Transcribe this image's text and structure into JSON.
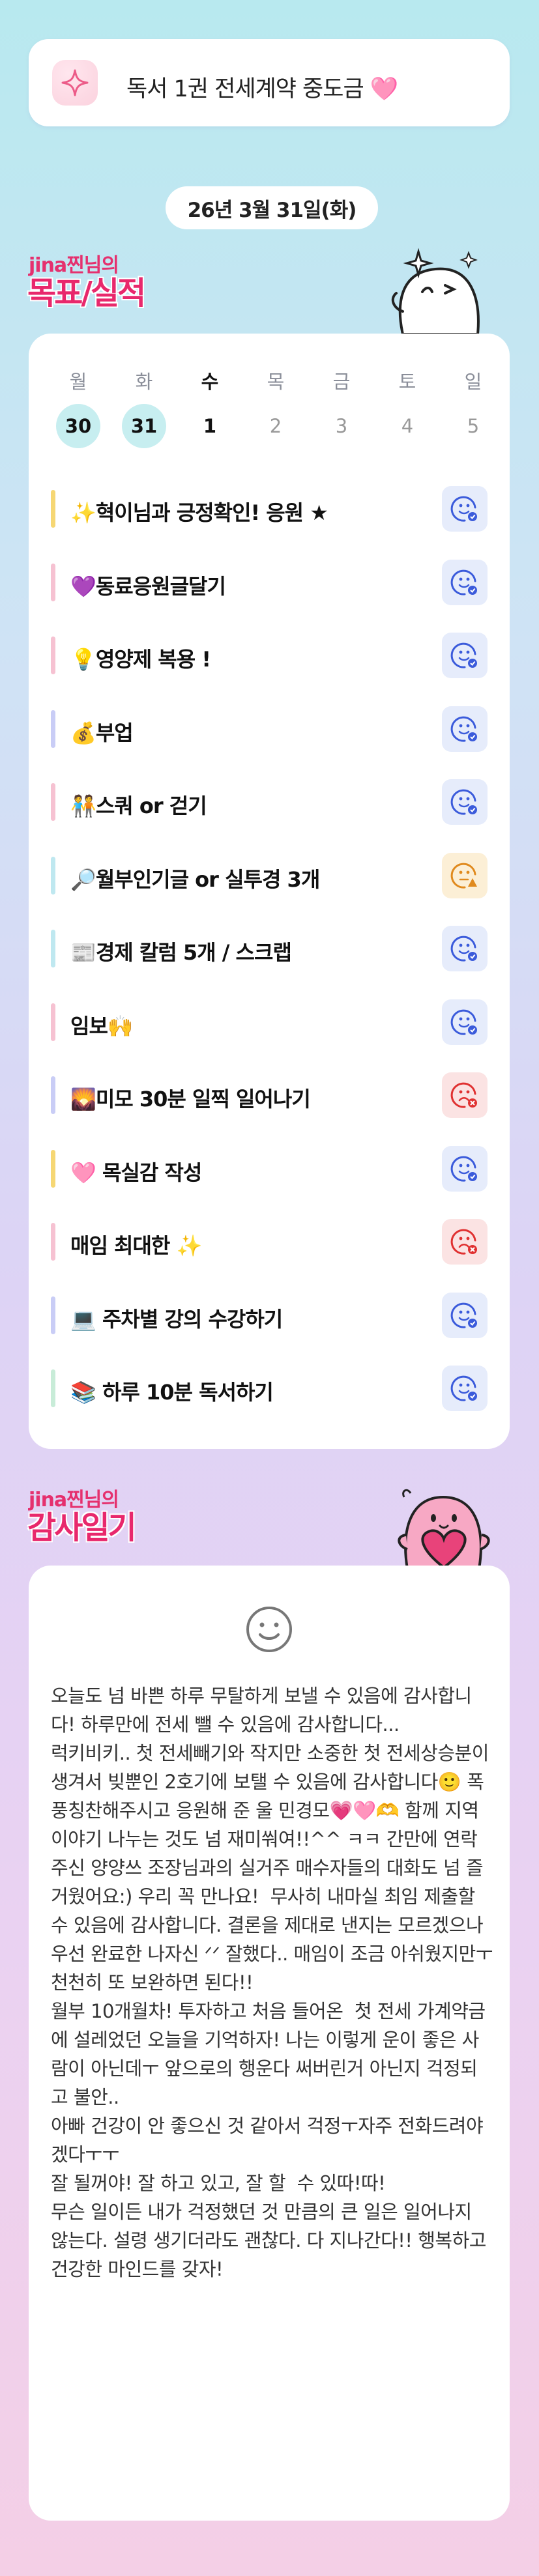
{
  "banner": {
    "text": "독서 1권 전세계약 중도금 🩷",
    "icon": "sparkle-icon"
  },
  "date": "26년 3월 31일(화)",
  "goals_section": {
    "owner": "jina찐님의",
    "title": "목표/실적"
  },
  "week": [
    {
      "day": "월",
      "num": "30",
      "state": "past"
    },
    {
      "day": "화",
      "num": "31",
      "state": "past"
    },
    {
      "day": "수",
      "num": "1",
      "state": "today"
    },
    {
      "day": "목",
      "num": "2",
      "state": "future"
    },
    {
      "day": "금",
      "num": "3",
      "state": "future"
    },
    {
      "day": "토",
      "num": "4",
      "state": "future"
    },
    {
      "day": "일",
      "num": "5",
      "state": "future"
    }
  ],
  "goals": [
    {
      "label": "✨혁이님과 긍정확인! 응원 ★",
      "bar": "#f6d774",
      "status": "good"
    },
    {
      "label": "💜동료응원글달기",
      "bar": "#f6c2d2",
      "status": "good"
    },
    {
      "label": "💡영양제 복용 !",
      "bar": "#f6c2d2",
      "status": "good"
    },
    {
      "label": "💰부업",
      "bar": "#c9cdf6",
      "status": "good"
    },
    {
      "label": "🧑‍🤝‍🧑스쿼 or 걷기",
      "bar": "#f6c2d2",
      "status": "good"
    },
    {
      "label": "🔎월부인기글 or 실투경 3개",
      "bar": "#bfe8f0",
      "status": "meh"
    },
    {
      "label": "📰경제 칼럼 5개 / 스크랩",
      "bar": "#bfe8f0",
      "status": "good"
    },
    {
      "label": "임보🙌",
      "bar": "#f6c2d2",
      "status": "good"
    },
    {
      "label": "🌄미모 30분 일찍 일어나기",
      "bar": "#c9cdf6",
      "status": "bad"
    },
    {
      "label": "🩷 목실감 작성",
      "bar": "#f6d774",
      "status": "good"
    },
    {
      "label": "매임 최대한 ✨",
      "bar": "#f6c2d2",
      "status": "bad"
    },
    {
      "label": "💻 주차별 강의 수강하기",
      "bar": "#c9cdf6",
      "status": "good"
    },
    {
      "label": "📚 하루 10분 독서하기",
      "bar": "#c8ecd8",
      "status": "good"
    }
  ],
  "status_icons": {
    "good": "happy-face-icon",
    "meh": "neutral-face-icon",
    "bad": "sad-face-icon"
  },
  "colors": {
    "accent": "#e8286c",
    "good": "#3b5bdb",
    "meh": "#e08a1e",
    "bad": "#e03131"
  },
  "gratitude_section": {
    "owner": "jina찐님의",
    "title": "감사일기",
    "mood_icon": "smile-icon"
  },
  "diary": "오늘도 넘 바쁜 하루 무탈하게 보낼 수 있음에 감사합니다! 하루만에 전세 뺄 수 있음에 감사합니다...\n럭키비키.. 첫 전세빼기와 작지만 소중한 첫 전세상승분이 생겨서 빚뿐인 2호기에 보탤 수 있음에 감사합니다🙂 폭풍칭찬해주시고 응원해 준 울 민경모💗🩷🫶 함께 지역 이야기 나누는 것도 넘 재미쒀여!!^^ ㅋㅋ 간만에 연락주신 양양쓰 조장님과의 실거주 매수자들의 대화도 넘 즐거웠어요:) 우리 꼭 만나요!  무사히 내마실 최임 제출할 수 있음에 감사합니다. 결론을 제대로 낸지는 모르겠으나 우선 완료한 나자신 ᐟᐟ 잘했다.. 매임이 조금 아쉬웠지만ㅜ\n천천히 또 보완하면 된다!!\n월부 10개월차! 투자하고 처음 들어온  첫 전세 가계약금에 설레었던 오늘을 기억하자! 나는 이렇게 운이 좋은 사람이 아닌데ㅜ 앞으로의 행운다 써버린거 아닌지 걱정되고 불안..\n아빠 건강이 안 좋으신 것 같아서 걱정ㅜ자주 전화드려야겠다ㅜㅜ\n잘 될꺼야! 잘 하고 있고, 잘 할  수 있따!따!\n무슨 일이든 내가 걱정했던 것 만큼의 큰 일은 일어나지 않는다. 설령 생기더라도 괜찮다. 다 지나간다!! 행복하고 건강한 마인드를 갖자!"
}
